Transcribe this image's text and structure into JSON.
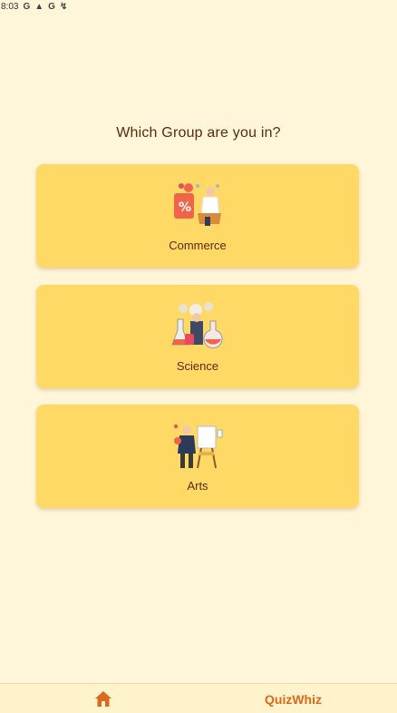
{
  "status_bar": {
    "time": "8:03",
    "icons": [
      "google-icon",
      "photos-icon",
      "google-icon",
      "sync-icon"
    ]
  },
  "question": "Which Group are you in?",
  "groups": [
    {
      "label": "Commerce",
      "icon": "commerce-illustration"
    },
    {
      "label": "Science",
      "icon": "science-illustration"
    },
    {
      "label": "Arts",
      "icon": "arts-illustration"
    }
  ],
  "bottom_nav": {
    "home_icon": "home-icon",
    "brand": "QuizWhiz"
  },
  "colors": {
    "background": "#FFF6D9",
    "card": "#FFD966",
    "text": "#5A2A0A",
    "accent": "#D9691E"
  }
}
